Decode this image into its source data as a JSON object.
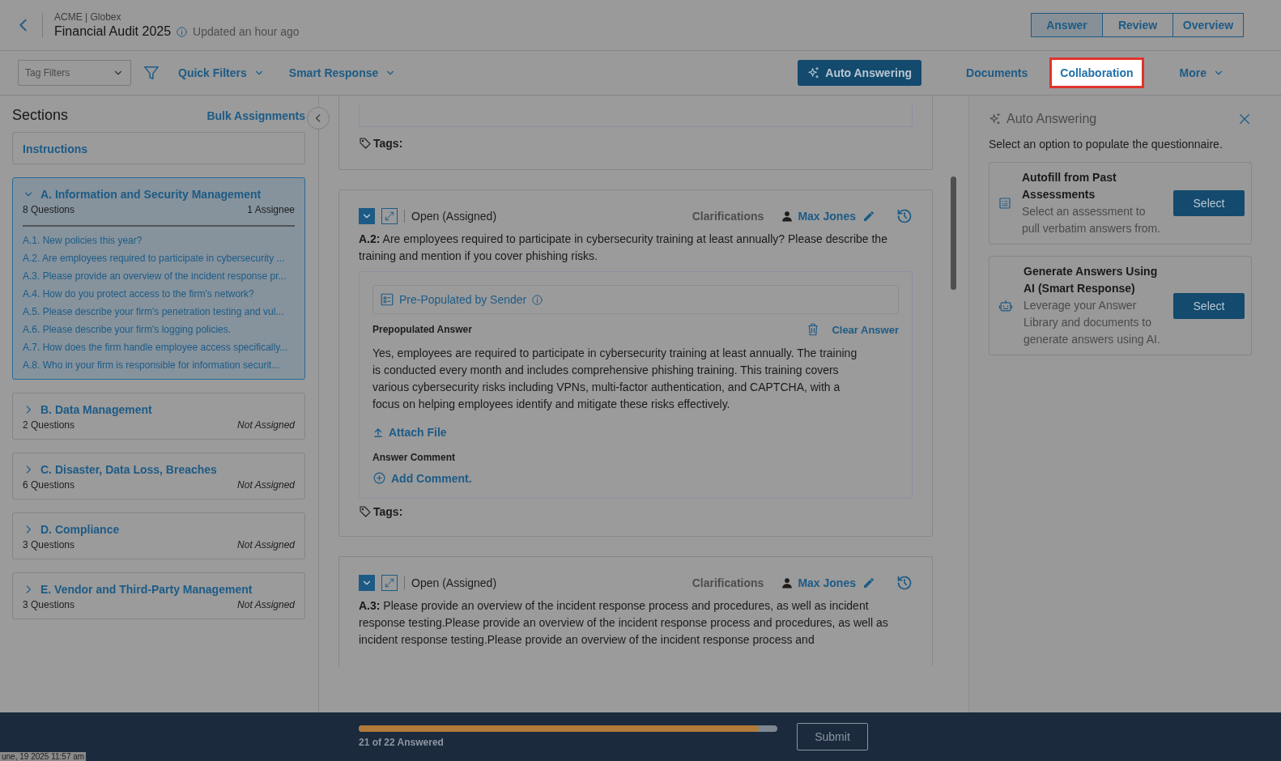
{
  "header": {
    "breadcrumb": "ACME | Globex",
    "title": "Financial Audit 2025",
    "updated": "Updated an hour ago",
    "view_tabs": [
      {
        "label": "Answer",
        "selected": true
      },
      {
        "label": "Review",
        "selected": false
      },
      {
        "label": "Overview",
        "selected": false
      }
    ]
  },
  "toolbar": {
    "tag_filter": {
      "placeholder": "Tag Filters"
    },
    "quick_filters": "Quick Filters",
    "smart_response": "Smart Response",
    "auto_answering": "Auto Answering",
    "links": [
      {
        "label": "Documents",
        "highlighted": false
      },
      {
        "label": "Collaboration",
        "highlighted": true
      }
    ],
    "more": "More"
  },
  "sidebar": {
    "title": "Sections",
    "bulk_assignments": "Bulk Assignments",
    "instructions": "Instructions",
    "sections": [
      {
        "title": "A. Information and Security Management",
        "count": "8 Questions",
        "assignee": "1 Assignee",
        "assigned": true,
        "expanded": true,
        "questions": [
          "A.1. New policies this year?",
          "A.2. Are employees required to participate in cybersecurity ...",
          "A.3. Please provide an overview of the incident response pr...",
          "A.4. How do you protect access to the firm's network?",
          "A.5. Please describe your firm's penetration testing and vul...",
          "A.6. Please describe your firm's logging policies.",
          "A.7. How does the firm handle employee access specifically...",
          "A.8. Who in your firm is responsible for information securit..."
        ]
      },
      {
        "title": "B. Data Management",
        "count": "2 Questions",
        "assignee": "Not Assigned",
        "assigned": false,
        "expanded": false
      },
      {
        "title": "C. Disaster, Data Loss, Breaches",
        "count": "6 Questions",
        "assignee": "Not Assigned",
        "assigned": false,
        "expanded": false
      },
      {
        "title": "D. Compliance",
        "count": "3 Questions",
        "assignee": "Not Assigned",
        "assigned": false,
        "expanded": false
      },
      {
        "title": "E. Vendor and Third-Party Management",
        "count": "3 Questions",
        "assignee": "Not Assigned",
        "assigned": false,
        "expanded": false
      }
    ]
  },
  "questions": [
    {
      "kind": "partial",
      "tags_label": "Tags:"
    },
    {
      "kind": "full",
      "status": "Open (Assigned)",
      "clarifications": "Clarifications",
      "assignee": "Max Jones",
      "number": "A.2:",
      "text": "Are employees required to participate in cybersecurity training at least annually? Please describe the training and mention if you cover phishing risks.",
      "source": "Pre-Populated by Sender",
      "answer_label": "Prepopulated Answer",
      "clear": "Clear Answer",
      "answer": "Yes, employees are required to participate in cybersecurity training at least annually. The training is conducted every month and includes comprehensive phishing training. This training covers various cybersecurity risks including VPNs, multi-factor authentication, and CAPTCHA, with a focus on helping employees identify and mitigate these risks effectively.",
      "attach": "Attach File",
      "comment_label": "Answer Comment",
      "add_comment": "Add Comment.",
      "tags_label": "Tags:"
    },
    {
      "kind": "head",
      "status": "Open (Assigned)",
      "clarifications": "Clarifications",
      "assignee": "Max Jones",
      "number": "A.3:",
      "text": "Please provide an overview of the incident response process and procedures, as well as incident response testing.Please provide an overview of the incident response process and procedures, as well as incident response testing.Please provide an overview of the incident response process and"
    }
  ],
  "panel": {
    "title": "Auto Answering",
    "intro": "Select an option to populate the questionnaire.",
    "options": [
      {
        "kind": "list",
        "title": "Autofill from Past Assessments",
        "description": "Select an assessment to pull verbatim answers from.",
        "button": "Select"
      },
      {
        "kind": "robot",
        "title": "Generate Answers Using AI (Smart Response)",
        "description": "Leverage your Answer Library and documents to generate answers using AI.",
        "button": "Select"
      }
    ]
  },
  "footer": {
    "progress": {
      "level": 0.955,
      "label": "21 of 22 Answered"
    },
    "submit": "Submit",
    "timestamp": "une, 19 2025 11:57 am"
  }
}
